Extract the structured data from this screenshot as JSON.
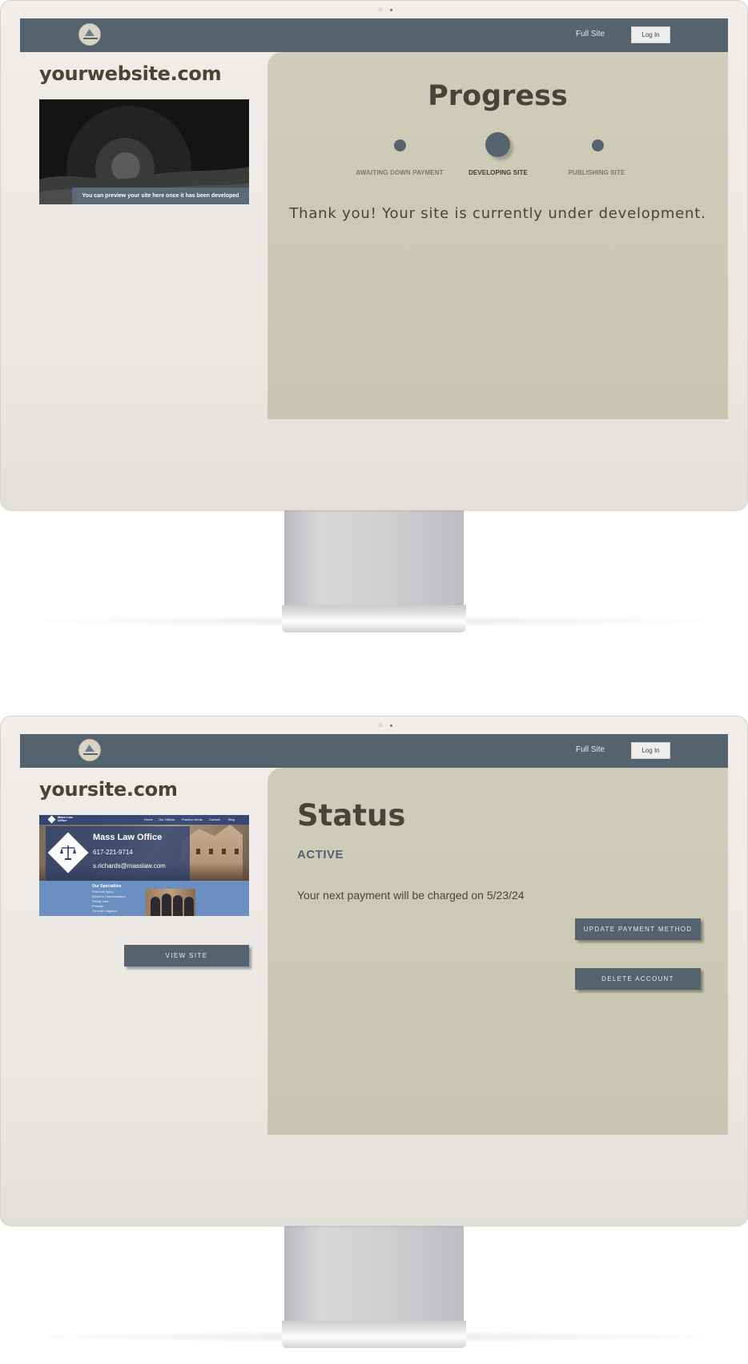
{
  "monitor_progress": {
    "nav": {
      "full_site_label": "Full Site",
      "login_label": "Log In"
    },
    "domain": "yourwebsite.com",
    "preview_caption": "You can preview your site here once it has been developed",
    "progress": {
      "title": "Progress",
      "steps": [
        {
          "label": "AWAITING DOWN PAYMENT",
          "state": "done"
        },
        {
          "label": "DEVELOPING SITE",
          "state": "current"
        },
        {
          "label": "PUBLISHING SITE",
          "state": "pending"
        }
      ],
      "message": "Thank you! Your site is currently under development."
    }
  },
  "monitor_status": {
    "nav": {
      "full_site_label": "Full Site",
      "login_label": "Log In"
    },
    "domain": "yoursite.com",
    "thumbnail": {
      "nav_name": "Mass Law Office",
      "menu": [
        "Home",
        "Our Offices",
        "Practice Areas",
        "Contact",
        "Blog"
      ],
      "firm_name": "Mass Law Office",
      "phone": "617-221-9714",
      "email": "s.richards@masslaw.com",
      "specialties_title": "Our Specialties",
      "specialties": [
        "Personal Injury",
        "Workers Compensation",
        "Family Law",
        "Probate",
        "General Litigation"
      ]
    },
    "view_site_label": "VIEW SITE",
    "status": {
      "title": "Status",
      "badge": "ACTIVE",
      "payment_note": "Your next payment will be charged on 5/23/24",
      "update_payment_label": "UPDATE PAYMENT METHOD",
      "delete_account_label": "DELETE ACCOUNT"
    }
  },
  "colors": {
    "nav": "#55636f",
    "panel": "#cfcdb9",
    "heading": "#4a4437",
    "accent": "#55636f"
  }
}
